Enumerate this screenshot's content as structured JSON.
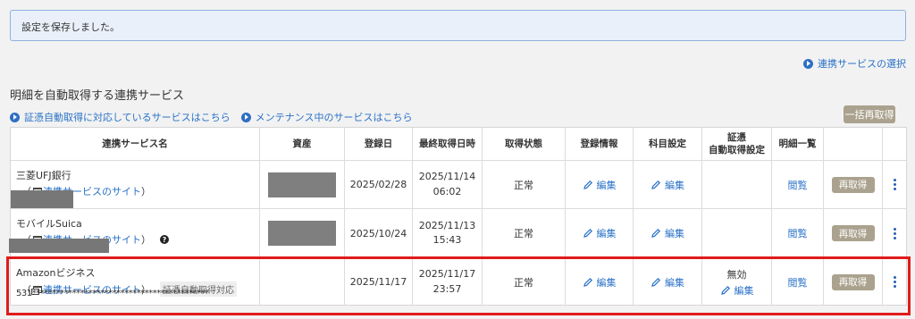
{
  "notice": {
    "text": "設定を保存しました。"
  },
  "select_link": {
    "label": "連携サービスの選択"
  },
  "section": {
    "title": "明細を自動取得する連携サービス"
  },
  "links": [
    {
      "label": "証憑自動取得に対応しているサービスはこちら"
    },
    {
      "label": "メンテナンス中のサービスはこちら"
    }
  ],
  "bulk_button": {
    "label": "一括再取得"
  },
  "table": {
    "headers": {
      "service": "連携サービス名",
      "asset": "資産",
      "registered": "登録日",
      "last_fetched": "最終取得日時",
      "status": "取得状態",
      "reg_info": "登録情報",
      "account_setting": "科目設定",
      "cert_line1": "証憑",
      "cert_line2": "自動取得設定",
      "details": "明細一覧"
    },
    "rows": [
      {
        "name": "三菱UFJ銀行",
        "site_open": "（",
        "site_link": "連携サービスのサイト",
        "site_close": "）",
        "registered": "2025/02/28",
        "fetched_date": "2025/11/14",
        "fetched_time": "06:02",
        "status": "正常",
        "edit": "編集",
        "view": "閲覧",
        "reget": "再取得"
      },
      {
        "name": "モバイルSuica",
        "site_open": "（",
        "site_link": "連携サービスのサイト",
        "site_close": "）",
        "help": "?",
        "registered": "2025/10/24",
        "fetched_date": "2025/11/13",
        "fetched_time": "15:43",
        "status": "正常",
        "edit": "編集",
        "view": "閲覧",
        "reget": "再取得"
      },
      {
        "name": "Amazonビジネス",
        "site_open": "（",
        "site_link": "連携サービスのサイト",
        "site_close": "）",
        "badge": "証憑自動取得対応",
        "account": "531********************************************",
        "registered": "2025/11/17",
        "fetched_date": "2025/11/17",
        "fetched_time": "23:57",
        "status": "正常",
        "edit": "編集",
        "cert_status": "無効",
        "view": "閲覧",
        "reget": "再取得"
      }
    ]
  },
  "colors": {
    "accent": "#2a72c7",
    "button": "#aaa28e",
    "highlight": "#e01b1b"
  }
}
